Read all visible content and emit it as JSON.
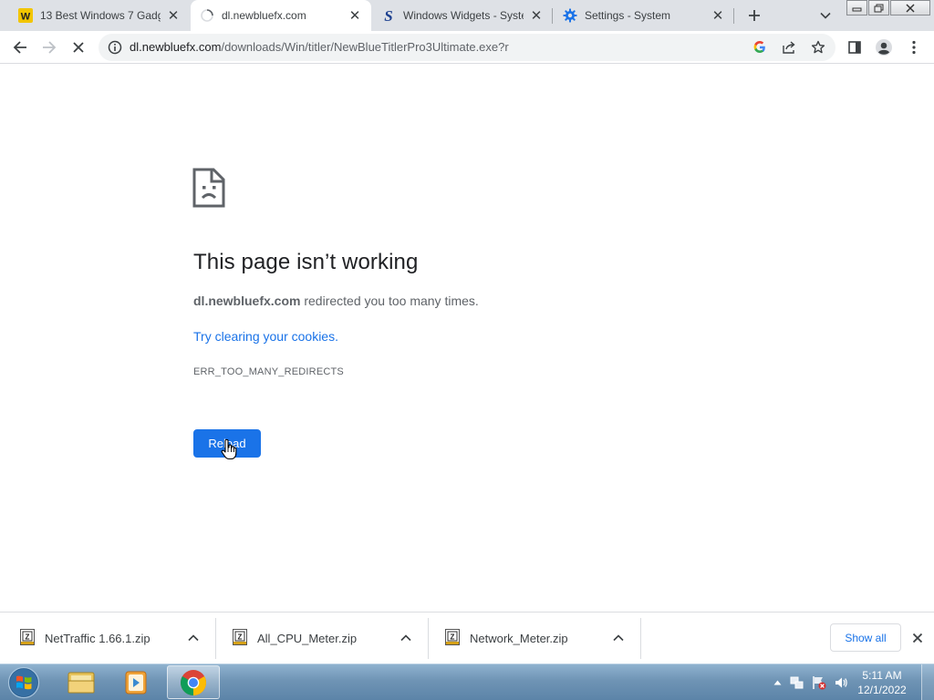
{
  "tabs": [
    {
      "title": "13 Best Windows 7 Gadg",
      "favicon": "w-logo-icon",
      "active": false
    },
    {
      "title": "dl.newbluefx.com",
      "favicon": "loading-spinner-icon",
      "active": true
    },
    {
      "title": "Windows Widgets - Syste",
      "favicon": "s-logo-icon",
      "active": false
    },
    {
      "title": "Settings - System",
      "favicon": "gear-icon",
      "active": false
    }
  ],
  "toolbar": {
    "url_host": "dl.newbluefx.com",
    "url_path": "/downloads/Win/titler/NewBlueTitlerPro3Ultimate.exe?r"
  },
  "error": {
    "title": "This page isn’t working",
    "domain": "dl.newbluefx.com",
    "message": " redirected you too many times.",
    "suggestion": "Try clearing your cookies.",
    "code": "ERR_TOO_MANY_REDIRECTS",
    "reload_label": "Reload"
  },
  "downloads": {
    "items": [
      {
        "name": "NetTraffic 1.66.1.zip"
      },
      {
        "name": "All_CPU_Meter.zip"
      },
      {
        "name": "Network_Meter.zip"
      }
    ],
    "show_all_label": "Show all"
  },
  "taskbar": {
    "apps": [
      "windows-explorer",
      "media-player",
      "google-chrome"
    ],
    "time": "5:11 AM",
    "date": "12/1/2022"
  },
  "colors": {
    "accent": "#1a73e8",
    "tabstrip": "#dee1e6",
    "taskbar": "#6f94b5"
  }
}
